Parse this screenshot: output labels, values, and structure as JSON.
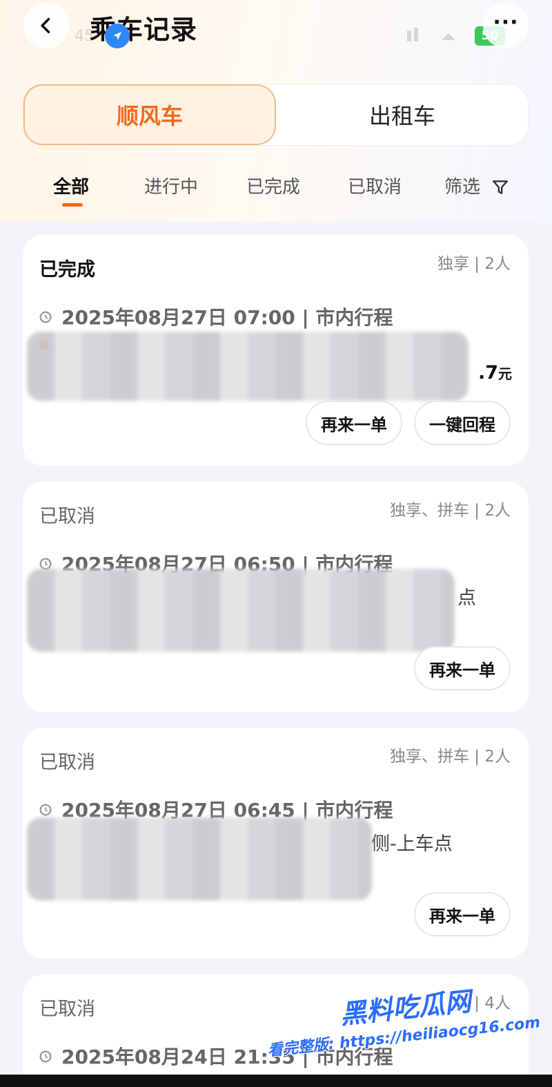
{
  "header": {
    "title": "乘车记录",
    "status_time": "45",
    "battery": "50",
    "back_icon": "chevron-left-icon",
    "more_label": "···",
    "location_icon": "navigation-arrow-icon"
  },
  "service_tabs": [
    {
      "label": "顺风车",
      "active": true
    },
    {
      "label": "出租车",
      "active": false
    }
  ],
  "status_tabs": [
    {
      "label": "全部",
      "active": true
    },
    {
      "label": "进行中",
      "active": false
    },
    {
      "label": "已完成",
      "active": false
    },
    {
      "label": "已取消",
      "active": false
    },
    {
      "label": "筛选",
      "active": false,
      "icon": "filter-icon"
    }
  ],
  "orders": [
    {
      "status": "已完成",
      "meta": "独享 | 2人",
      "time": "2025年08月27日 07:00 | 市内行程",
      "route_partial": "",
      "price": ".7",
      "price_unit": "元",
      "buttons": [
        "再来一单",
        "一键回程"
      ]
    },
    {
      "status": "已取消",
      "meta": "独享、拼车 | 2人",
      "time": "2025年08月27日 06:50 | 市内行程",
      "route_partial": "点",
      "buttons": [
        "再来一单"
      ]
    },
    {
      "status": "已取消",
      "meta": "独享、拼车 | 2人",
      "time": "2025年08月27日 06:45 | 市内行程",
      "route_partial": "侧-上车点",
      "buttons": [
        "再来一单"
      ]
    },
    {
      "status": "已取消",
      "meta": "享 | 4人",
      "time": "2025年08月24日 21:35 | 市内行程"
    }
  ],
  "watermark": {
    "logo": "黑料吃瓜网",
    "url": "看完整版: https://heiliaocg16.com"
  },
  "colors": {
    "accent": "#f06a1a",
    "route_origin": "#f57c1f",
    "watermark": "#2a6cff"
  }
}
